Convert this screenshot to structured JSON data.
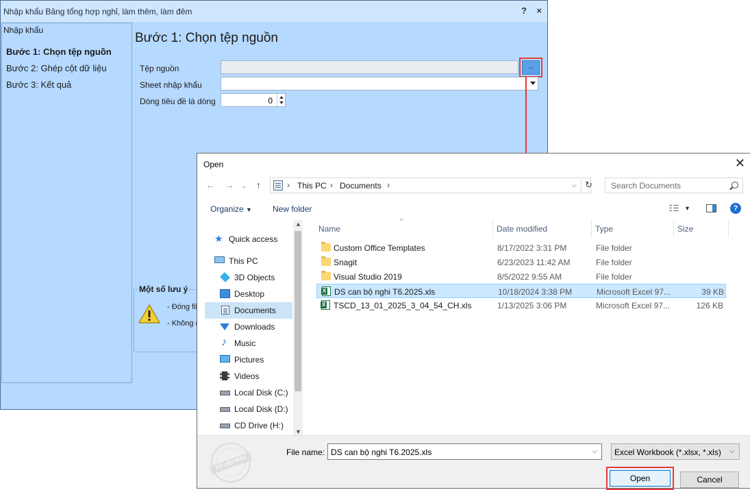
{
  "wizard": {
    "title": "Nhập khẩu Bảng tổng hợp nghỉ, làm thêm, làm đêm",
    "help": "?",
    "close": "×",
    "steps_heading": "Nhập khẩu",
    "steps": [
      "Bước 1: Chọn tệp nguồn",
      "Bước 2: Ghép cột dữ liệu",
      "Bước 3: Kết quả"
    ],
    "active_step": 0,
    "main_title": "Bước 1: Chọn tệp nguồn",
    "fields": {
      "source_file_label": "Tệp nguồn",
      "sheet_label": "Sheet nhập khẩu",
      "header_row_label": "Dòng tiêu đề là dòng",
      "header_row_value": "0"
    },
    "browse_label": "...",
    "notes": {
      "title": "Một số lưu ý",
      "items": [
        "- Đóng fil",
        "- Không r"
      ]
    }
  },
  "dialog": {
    "title": "Open",
    "close": "✕",
    "nav": {
      "back": "←",
      "forward": "→",
      "up": "↑",
      "refresh": "↻"
    },
    "address": [
      "This PC",
      "Documents"
    ],
    "search_placeholder": "Search Documents",
    "toolbar": {
      "organize": "Organize",
      "new_folder": "New folder",
      "help": "?"
    },
    "nav_pane": [
      {
        "label": "Quick access",
        "icon": "star-icon"
      },
      {
        "label": "This PC",
        "icon": "computer-icon"
      },
      {
        "label": "3D Objects",
        "icon": "cube-icon"
      },
      {
        "label": "Desktop",
        "icon": "desktop-icon"
      },
      {
        "label": "Documents",
        "icon": "documents-icon",
        "selected": true
      },
      {
        "label": "Downloads",
        "icon": "download-icon"
      },
      {
        "label": "Music",
        "icon": "music-icon"
      },
      {
        "label": "Pictures",
        "icon": "pictures-icon"
      },
      {
        "label": "Videos",
        "icon": "videos-icon"
      },
      {
        "label": "Local Disk (C:)",
        "icon": "disk-icon"
      },
      {
        "label": "Local Disk (D:)",
        "icon": "disk-icon"
      },
      {
        "label": "CD Drive (H:)",
        "icon": "disk-icon"
      }
    ],
    "columns": [
      "Name",
      "Date modified",
      "Type",
      "Size"
    ],
    "files": [
      {
        "name": "Custom Office Templates",
        "date": "8/17/2022 3:31 PM",
        "type": "File folder",
        "size": "",
        "icon": "folder-icon"
      },
      {
        "name": "Snagit",
        "date": "6/23/2023 11:42 AM",
        "type": "File folder",
        "size": "",
        "icon": "folder-icon"
      },
      {
        "name": "Visual Studio 2019",
        "date": "8/5/2022 9:55 AM",
        "type": "File folder",
        "size": "",
        "icon": "folder-icon"
      },
      {
        "name": "DS can bộ nghi T6.2025.xls",
        "date": "10/18/2024 3:38 PM",
        "type": "Microsoft Excel 97...",
        "size": "39 KB",
        "icon": "excel-file-icon",
        "selected": true
      },
      {
        "name": "TSCD_13_01_2025_3_04_54_CH.xls",
        "date": "1/13/2025 3:06 PM",
        "type": "Microsoft Excel 97...",
        "size": "126 KB",
        "icon": "excel-file-icon"
      }
    ],
    "file_name_label": "File name:",
    "file_name_value": "DS can bộ nghi T6.2025.xls",
    "file_type": "Excel Workbook (*.xlsx, *.xls)",
    "open_label": "Open",
    "cancel_label": "Cancel",
    "watermark": "DỮ LIỆU MẪU"
  },
  "colors": {
    "wizard_bg": "#b6d9ff",
    "highlight": "#e23b3b",
    "selection": "#cce8ff",
    "accent": "#0078d7"
  }
}
